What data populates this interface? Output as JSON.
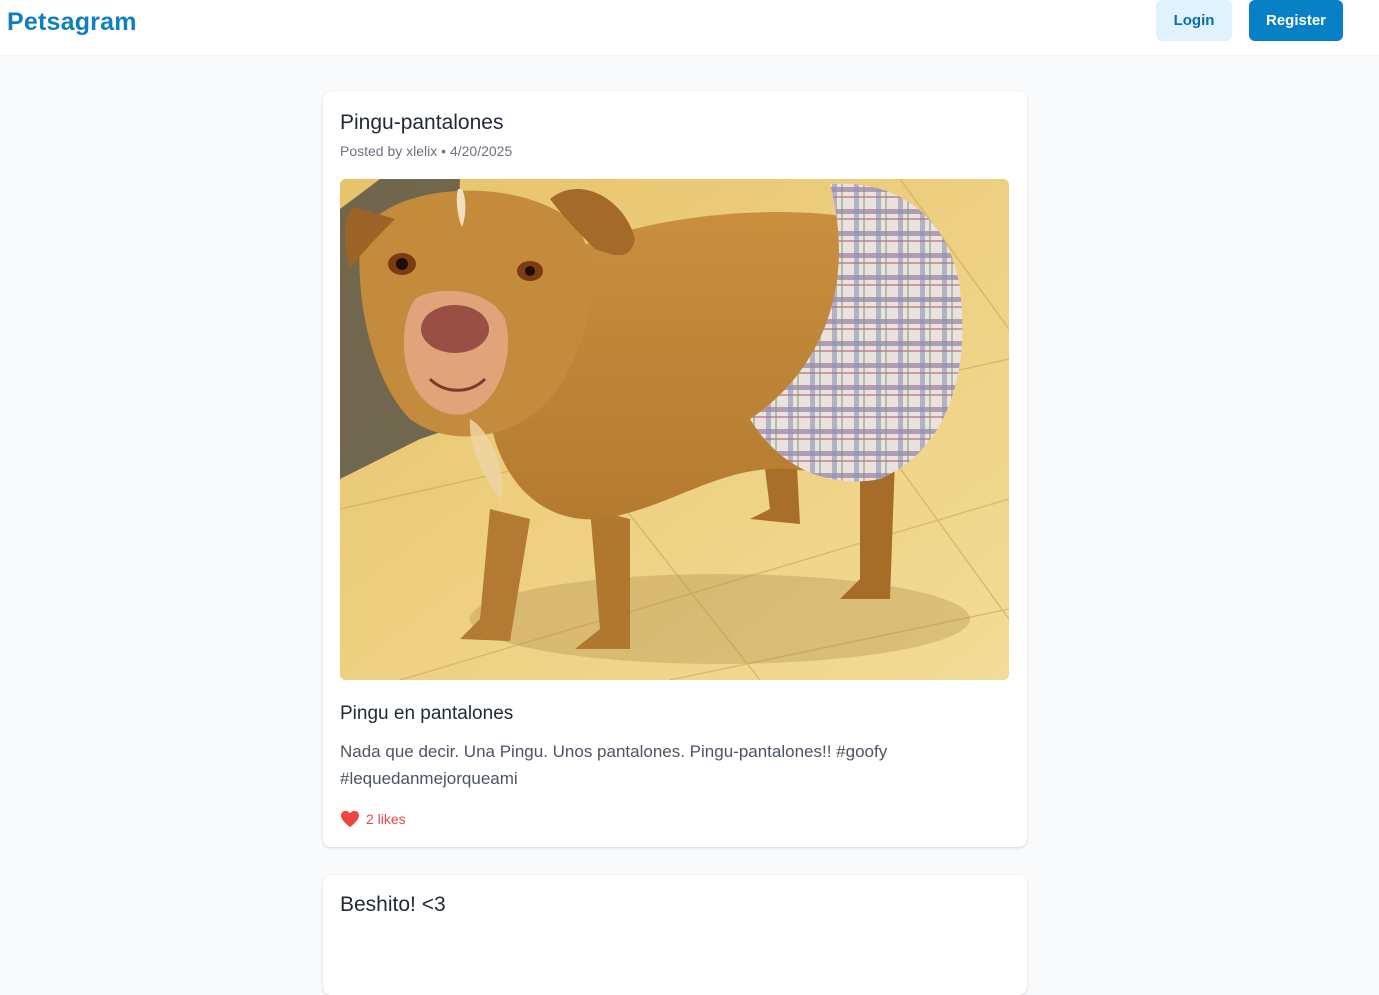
{
  "header": {
    "brand": "Petsagram",
    "login_label": "Login",
    "register_label": "Register"
  },
  "posts": [
    {
      "title": "Pingu-pantalones",
      "meta": "Posted by xlelix • 4/20/2025",
      "caption": "Pingu en pantalones",
      "description": "Nada que decir. Una Pingu. Unos pantalones. Pingu-pantalones!! #goofy #lequedanmejorqueami",
      "likes": "2 likes",
      "icon": "heart-icon"
    },
    {
      "title": "Beshito! <3"
    }
  ],
  "colors": {
    "brand": "#0e7fc0",
    "primary": "#0780c5",
    "primary_light": "#e0f2fe",
    "like": "#ef4444",
    "background": "#f8fafc"
  }
}
